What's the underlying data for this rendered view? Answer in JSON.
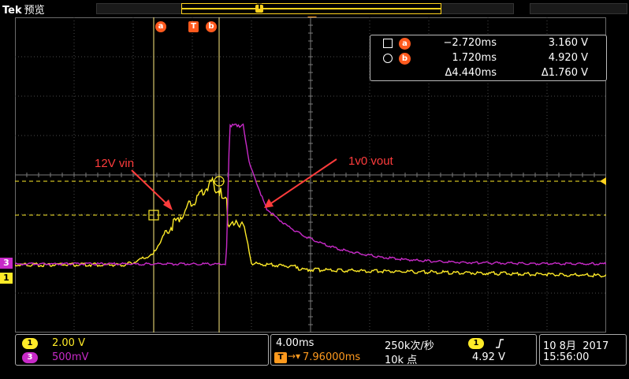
{
  "brand": {
    "name": "Tek",
    "mode": "预览"
  },
  "cursors": {
    "a_label": "a",
    "b_label": "b",
    "trigger_label": "T",
    "readout": {
      "a": {
        "time": "−2.720ms",
        "volt": "3.160 V"
      },
      "b": {
        "time": "1.720ms",
        "volt": "4.920 V"
      },
      "delta": {
        "time": "Δ4.440ms",
        "volt": "Δ1.760 V"
      }
    }
  },
  "channels": {
    "ch1": {
      "label": "1",
      "scale": "2.00 V",
      "color": "#ffeb28"
    },
    "ch3": {
      "label": "3",
      "scale": "500mV",
      "color": "#c82ac8"
    }
  },
  "annotations": {
    "vin": "12V vin",
    "vout": "1v0 vout",
    "arrow_color": "#ff3c3c"
  },
  "horizontal": {
    "timebase": "4.00ms",
    "sample_rate": "250k次/秒",
    "trigger_delay": "7.96000ms",
    "record_length": "10k 点",
    "trigger_source": "1",
    "trigger_level": "4.92 V"
  },
  "datetime": {
    "date": "10 8月  2017",
    "time": "15:56:00"
  },
  "colors": {
    "ch1": "#ffeb28",
    "ch3": "#c82ac8",
    "cursor_badge": "#ff5a1e",
    "grid": "#5a5a5a"
  }
}
